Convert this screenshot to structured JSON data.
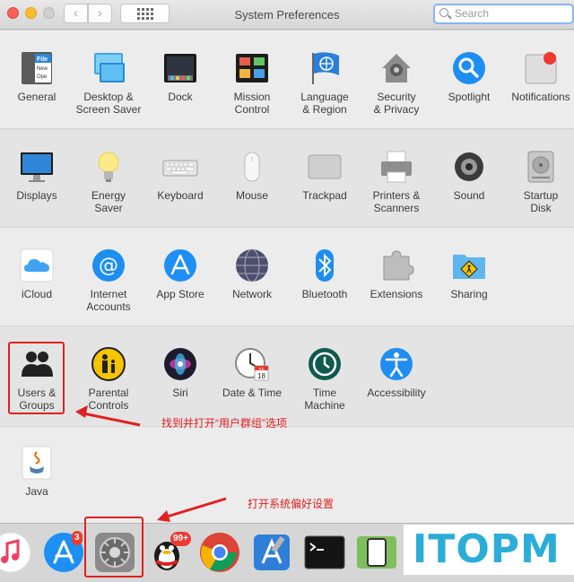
{
  "window": {
    "title": "System Preferences"
  },
  "search": {
    "placeholder": "Search"
  },
  "nav": {
    "back": "‹",
    "forward": "›"
  },
  "sections": {
    "personal": [
      "General",
      "Desktop &\nScreen Saver",
      "Dock",
      "Mission\nControl",
      "Language\n& Region",
      "Security\n& Privacy",
      "Spotlight",
      "Notifications"
    ],
    "hardware": [
      "Displays",
      "Energy\nSaver",
      "Keyboard",
      "Mouse",
      "Trackpad",
      "Printers &\nScanners",
      "Sound",
      "Startup\nDisk"
    ],
    "internet": [
      "iCloud",
      "Internet\nAccounts",
      "App Store",
      "Network",
      "Bluetooth",
      "Extensions",
      "Sharing"
    ],
    "system": [
      "Users &\nGroups",
      "Parental\nControls",
      "Siri",
      "Date & Time",
      "Time\nMachine",
      "Accessibility"
    ],
    "other": [
      "Java"
    ]
  },
  "general_icon_text": {
    "file": "File",
    "new": "New",
    "ope": "Ope"
  },
  "calendar_icon": {
    "month": "JUL",
    "day": "18"
  },
  "dock": {
    "app_store_badge": "3",
    "qq_badge": "99+"
  },
  "annotations": {
    "users_groups": "找到并打开“用户群组”选项",
    "system_prefs": "打开系统偏好设置"
  },
  "watermark": "ITOPM",
  "colors": {
    "annotation_red": "#e02020",
    "search_focus": "#86b6f3",
    "watermark": "#2badd8"
  }
}
